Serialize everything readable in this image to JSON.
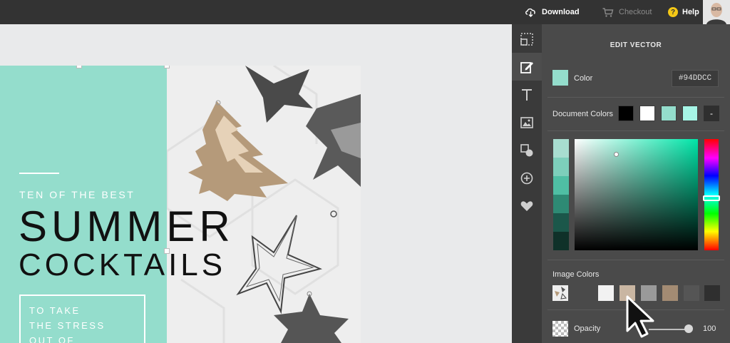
{
  "topbar": {
    "download_label": "Download",
    "checkout_label": "Checkout",
    "help_label": "Help",
    "help_badge": "?"
  },
  "design": {
    "kicker": "TEN OF THE BEST",
    "title_line1": "SUMMER",
    "title_line2": "COCKTAILS",
    "sub_text": "TO TAKE\nTHE STRESS\nOUT OF",
    "block_color": "#94DDCC"
  },
  "tools": [
    "crop-icon",
    "edit-icon",
    "text-icon",
    "image-icon",
    "shapes-icon",
    "add-icon",
    "heart-icon"
  ],
  "panel": {
    "title": "EDIT VECTOR",
    "color_label": "Color",
    "color_hex": "#94DDCC",
    "document_colors_label": "Document Colors",
    "document_colors": [
      "#000000",
      "#ffffff",
      "#94DDCC",
      "#a6f5e6"
    ],
    "minus_label": "-",
    "shades": [
      "#a8ddd0",
      "#7dcfbb",
      "#4fbfa4",
      "#2e8a74",
      "#1b574a",
      "#0f3129"
    ],
    "image_colors_label": "Image Colors",
    "image_colors": [
      "#f2f2f2",
      "#c9b6a2",
      "#9a9a9a",
      "#a38b73",
      "#555555",
      "#2f2f2f"
    ],
    "opacity_label": "Opacity",
    "opacity_value": "100"
  }
}
